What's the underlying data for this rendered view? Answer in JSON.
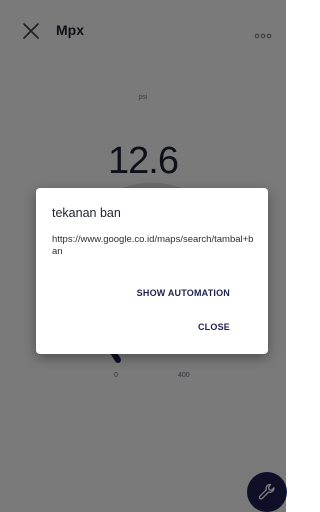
{
  "app_bar": {
    "title": "Mpx",
    "close_icon": "close-icon",
    "more_icon": "more-horizontal-icon"
  },
  "gauge": {
    "unit": "psi",
    "value": "12.6",
    "tick_min": "0",
    "tick_max": "400",
    "fill_fraction": 0.03
  },
  "dialog": {
    "title": "tekanan ban",
    "message": "https://www.google.co.id/maps/search/tambal+ban",
    "buttons": {
      "show_automation": "SHOW AUTOMATION",
      "close": "CLOSE"
    }
  },
  "fab": {
    "icon": "wrench-icon"
  },
  "colors": {
    "accent": "#1e2150",
    "track": "#d7d8dc",
    "scrim": "rgba(0,0,0,0.5)"
  }
}
